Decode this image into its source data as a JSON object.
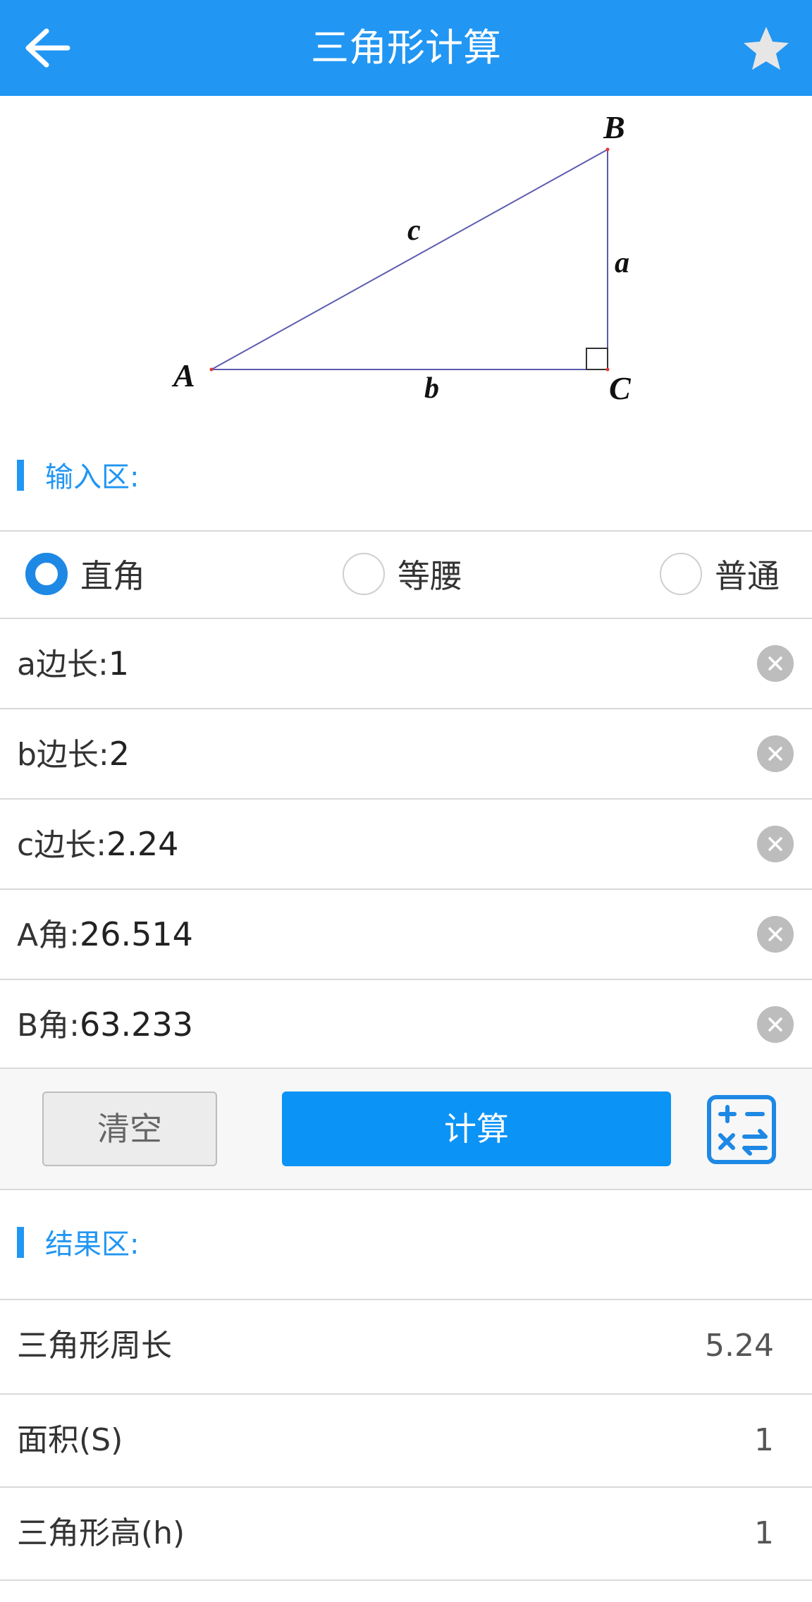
{
  "header": {
    "title": "三角形计算",
    "back_icon": "arrow-left-icon",
    "favorite_icon": "star-icon",
    "bg_color": "#2196F3"
  },
  "diagram": {
    "vertex_a": "A",
    "vertex_b": "B",
    "vertex_c": "C",
    "side_a": "a",
    "side_b": "b",
    "side_c": "c"
  },
  "input_section": {
    "title": "输入区:",
    "triangle_types": [
      {
        "label": "直角",
        "selected": true
      },
      {
        "label": "等腰",
        "selected": false
      },
      {
        "label": "普通",
        "selected": false
      }
    ],
    "fields": [
      {
        "label": "a边长:",
        "value": "1"
      },
      {
        "label": "b边长:",
        "value": "2"
      },
      {
        "label": "c边长:",
        "value": "2.24"
      },
      {
        "label": "A角:",
        "value": "26.514"
      },
      {
        "label": "B角:",
        "value": "63.233"
      }
    ]
  },
  "actions": {
    "clear_label": "清空",
    "calc_label": "计算",
    "calculator_icon": "calculator-icon"
  },
  "result_section": {
    "title": "结果区:",
    "rows": [
      {
        "label": "三角形周长",
        "value": "5.24"
      },
      {
        "label": "面积(S)",
        "value": "1"
      },
      {
        "label": "三角形高(h)",
        "value": "1"
      }
    ]
  },
  "colors": {
    "accent": "#2196F3",
    "button": "#0B93F6",
    "divider": "#d9d9d9"
  }
}
